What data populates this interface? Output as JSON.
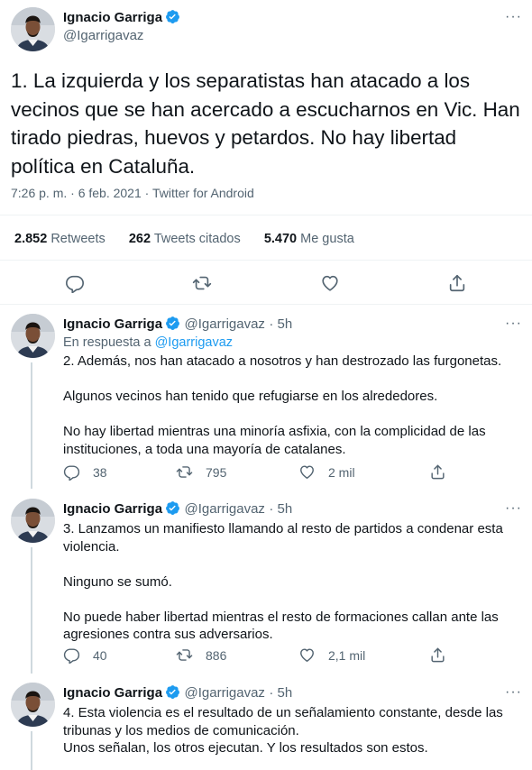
{
  "main_tweet": {
    "author_name": "Ignacio Garriga",
    "author_handle": "@Igarrigavaz",
    "text": "1. La izquierda y los separatistas han atacado a los vecinos que se han acercado a escucharnos en Vic. Han tirado piedras, huevos y petardos. No hay libertad política en Cataluña.",
    "meta": "7:26 p. m. · 6 feb. 2021 · Twitter for Android",
    "stats": {
      "retweets_count": "2.852",
      "retweets_label": "Retweets",
      "quotes_count": "262",
      "quotes_label": "Tweets citados",
      "likes_count": "5.470",
      "likes_label": "Me gusta"
    }
  },
  "replies": [
    {
      "author_name": "Ignacio Garriga",
      "author_handle": "@Igarrigavaz",
      "time": "· 5h",
      "reply_prefix": "En respuesta a ",
      "reply_to": "@Igarrigavaz",
      "text": "2. Además, nos han atacado a nosotros y han destrozado las furgonetas.\n\nAlgunos vecinos han tenido que refugiarse en los alrededores.\n\nNo hay libertad mientras una minoría asfixia, con la complicidad de las instituciones, a toda una mayoría de catalanes.",
      "replies": "38",
      "retweets": "795",
      "likes": "2 mil"
    },
    {
      "author_name": "Ignacio Garriga",
      "author_handle": "@Igarrigavaz",
      "time": "· 5h",
      "text": "3. Lanzamos un manifiesto llamando al resto de partidos a condenar esta violencia.\n\nNinguno se sumó.\n\nNo puede haber libertad mientras el resto de formaciones callan ante las agresiones contra sus adversarios.",
      "replies": "40",
      "retweets": "886",
      "likes": "2,1 mil"
    },
    {
      "author_name": "Ignacio Garriga",
      "author_handle": "@Igarrigavaz",
      "time": "· 5h",
      "text": "4. Esta violencia es el resultado de un señalamiento constante, desde las tribunas y los medios de comunicación.\nUnos señalan, los otros ejecutan. Y los resultados son estos."
    }
  ],
  "more_glyph": "···",
  "colors": {
    "accent": "#1d9bf0",
    "secondary_text": "#536471",
    "divider": "#eff3f4"
  }
}
